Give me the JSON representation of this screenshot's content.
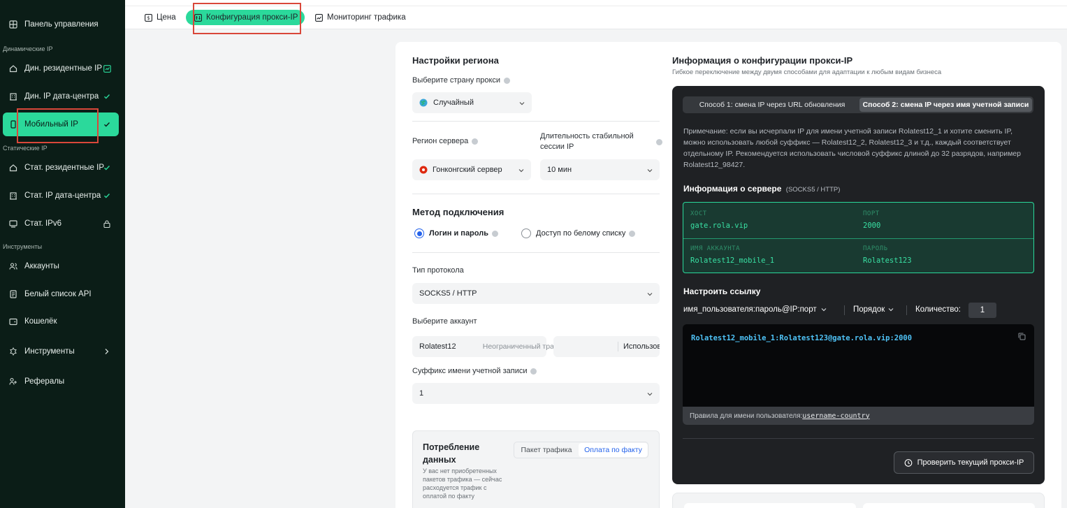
{
  "sidebar": {
    "dashboard": "Панель управления",
    "section_dynamic": "Динамические IP",
    "dyn_residential": "Дин. резидентные IP",
    "dyn_datacenter": "Дин. IP дата-центра",
    "mobile": "Мобильный IP",
    "section_static": "Статические IP",
    "stat_residential": "Стат. резидентные IP",
    "stat_datacenter": "Стат. IP дата-центра",
    "stat_ipv6": "Стат. IPv6",
    "section_tools": "Инструменты",
    "accounts": "Аккаунты",
    "whitelist_api": "Белый список API",
    "wallet": "Кошелёк",
    "tools": "Инструменты",
    "referrals": "Рефералы"
  },
  "tabs": {
    "price": "Цена",
    "proxy_config": "Конфигурация прокси-IP",
    "traffic_monitor": "Мониторинг трафика"
  },
  "region": {
    "title": "Настройки региона",
    "country_label": "Выберите страну прокси",
    "country_value": "Случайный",
    "server_label": "Регион сервера",
    "server_value": "Гонконгский сервер",
    "duration_label": "Длительность стабильной сессии IP",
    "duration_value": "10 мин"
  },
  "connection": {
    "title": "Метод подключения",
    "login_option": "Логин и пароль",
    "whitelist_option": "Доступ по белому списку",
    "protocol_label": "Тип протокола",
    "protocol_value": "SOCKS5 / HTTP",
    "account_label": "Выберите аккаунт",
    "account_value": "Rolatest12",
    "account_traffic": "Неограниченный трафик",
    "account_used": "Использовано",
    "suffix_label": "Суффикс имени учетной записи",
    "suffix_value": "1"
  },
  "usage": {
    "title": "Потребление данных",
    "note": "У вас нет приобретенных пакетов трафика — сейчас расходуется трафик с оплатой по факту",
    "opt_package": "Пакет трафика",
    "opt_payg": "Оплата по факту"
  },
  "info": {
    "title": "Информация о конфигурации прокси-IP",
    "subtitle": "Гибкое переключение между двумя способами для адаптации к любым видам бизнеса",
    "method1": "Способ 1: смена IP через URL обновления",
    "method2": "Способ 2: смена IP через имя учетной записи",
    "note": "Примечание: если вы исчерпали IP для имени учетной записи Rolatest12_1 и хотите сменить IP, можно использовать любой суффикс — Rolatest12_2, Rolatest12_3 и т.д., каждый соответствует отдельному IP. Рекомендуется использовать числовой суффикс длиной до 32 разрядов, например Rolatest12_98427.",
    "server_title": "Информация о сервере",
    "server_protocol": "(SOCKS5 / HTTP)",
    "host_label": "ХОСТ",
    "host_value": "gate.rola.vip",
    "port_label": "ПОРТ",
    "port_value": "2000",
    "account_label": "ИМЯ АККАУНТА",
    "account_value": "Rolatest12_mobile_1",
    "password_label": "ПАРОЛЬ",
    "password_value": "Rolatest123",
    "link_title": "Настроить ссылку",
    "format": "имя_пользователя:пароль@IP:порт",
    "order": "Порядок",
    "quantity_label": "Количество:",
    "quantity_value": "1",
    "code": "Rolatest12_mobile_1:Rolatest123@gate.rola.vip:2000",
    "rules_label": "Правила для имени пользователя:",
    "rules_value": "username-country",
    "check_button": "Проверить текущий прокси-IP"
  },
  "colors": {
    "accent": "#2bd99b",
    "sidebar_bg": "#0b1d17",
    "highlight": "#d9473a",
    "dark_panel": "#1f2124",
    "radio": "#2563eb"
  }
}
